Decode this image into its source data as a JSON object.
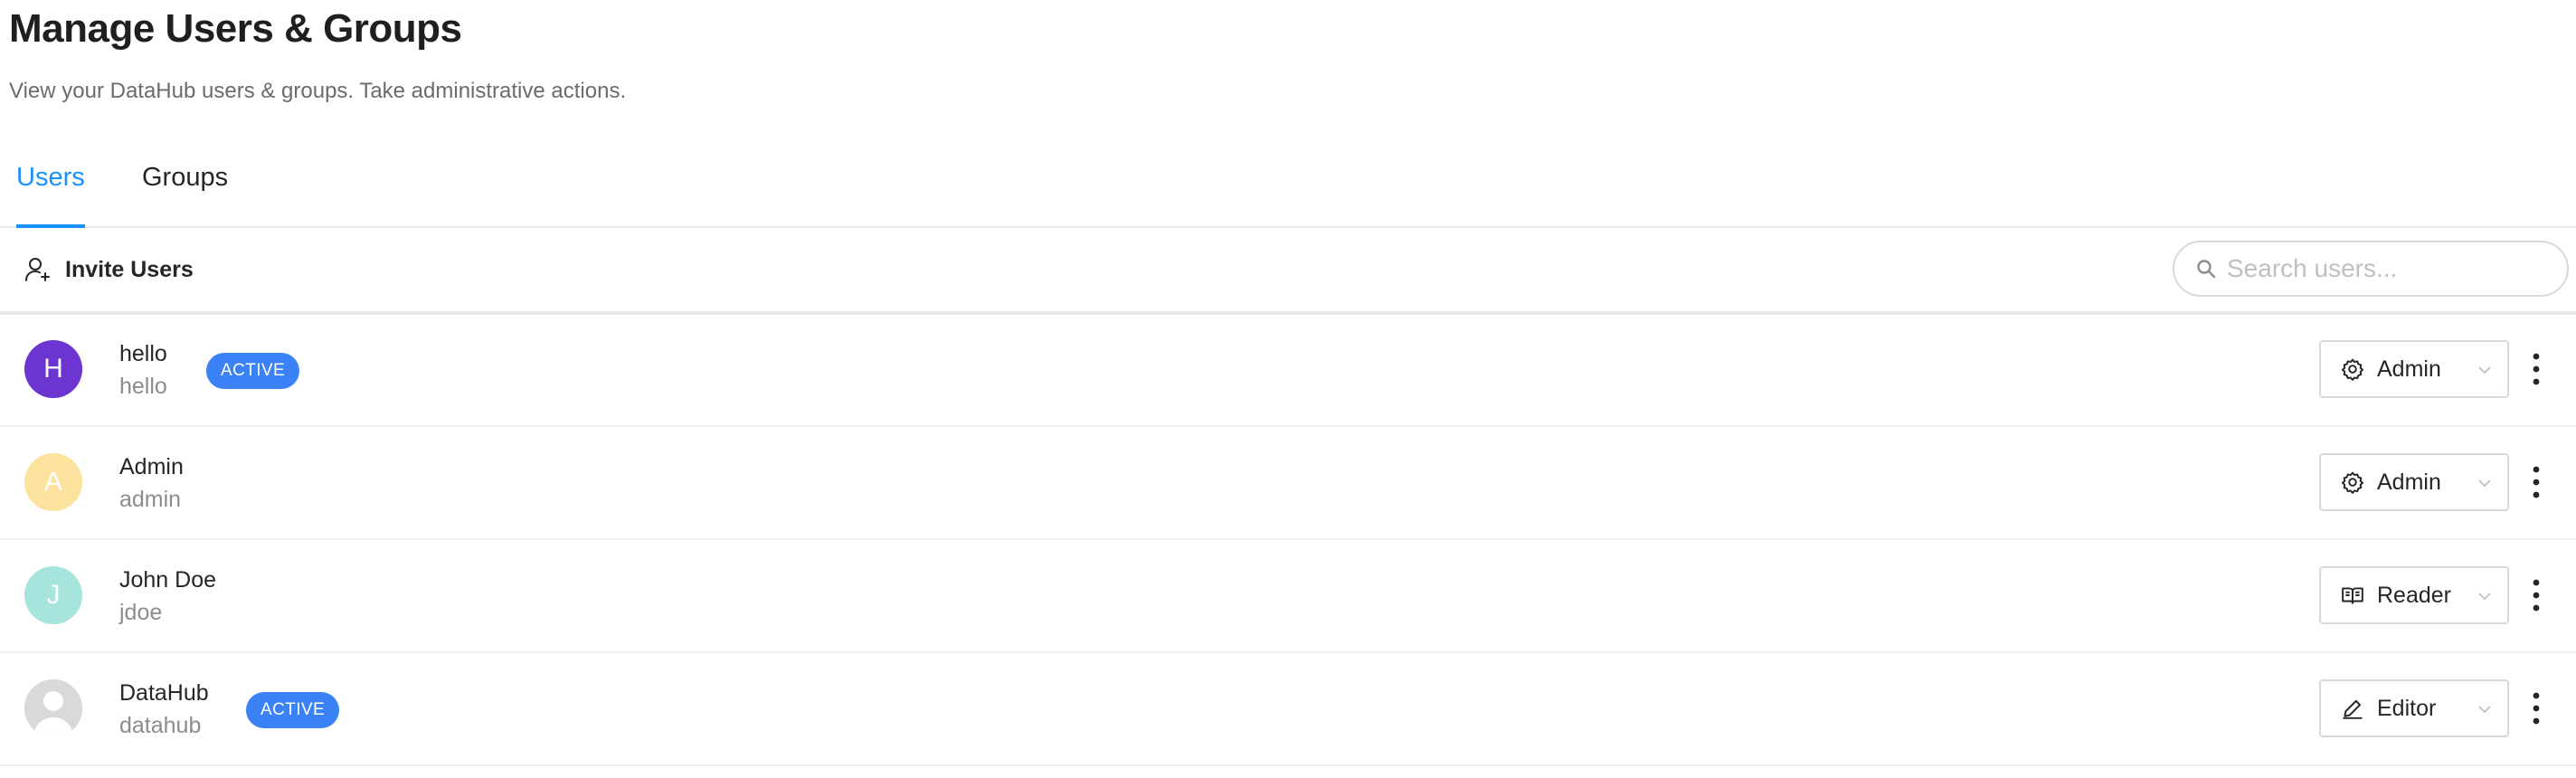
{
  "page": {
    "title": "Manage Users & Groups",
    "subtitle": "View your DataHub users & groups. Take administrative actions."
  },
  "tabs": [
    {
      "label": "Users",
      "active": true
    },
    {
      "label": "Groups",
      "active": false
    }
  ],
  "toolbar": {
    "invite_label": "Invite Users",
    "invite_icon": "user-add-icon",
    "search_placeholder": "Search users...",
    "search_icon": "search-icon"
  },
  "users": [
    {
      "avatar_letter": "H",
      "avatar_color": "#6c35d1",
      "name": "hello",
      "username": "hello",
      "status": "ACTIVE",
      "role": "Admin",
      "role_icon": "gear-icon"
    },
    {
      "avatar_letter": "A",
      "avatar_color": "#fbe39e",
      "name": "Admin",
      "username": "admin",
      "status": "",
      "role": "Admin",
      "role_icon": "gear-icon"
    },
    {
      "avatar_letter": "J",
      "avatar_color": "#a6e4dc",
      "name": "John Doe",
      "username": "jdoe",
      "status": "",
      "role": "Reader",
      "role_icon": "book-icon"
    },
    {
      "avatar_letter": "",
      "avatar_color": "#d9d9d9",
      "name": "DataHub",
      "username": "datahub",
      "status": "ACTIVE",
      "role": "Editor",
      "role_icon": "pencil-icon"
    }
  ],
  "colors": {
    "accent": "#1890ff",
    "active_badge": "#3b82f6"
  }
}
